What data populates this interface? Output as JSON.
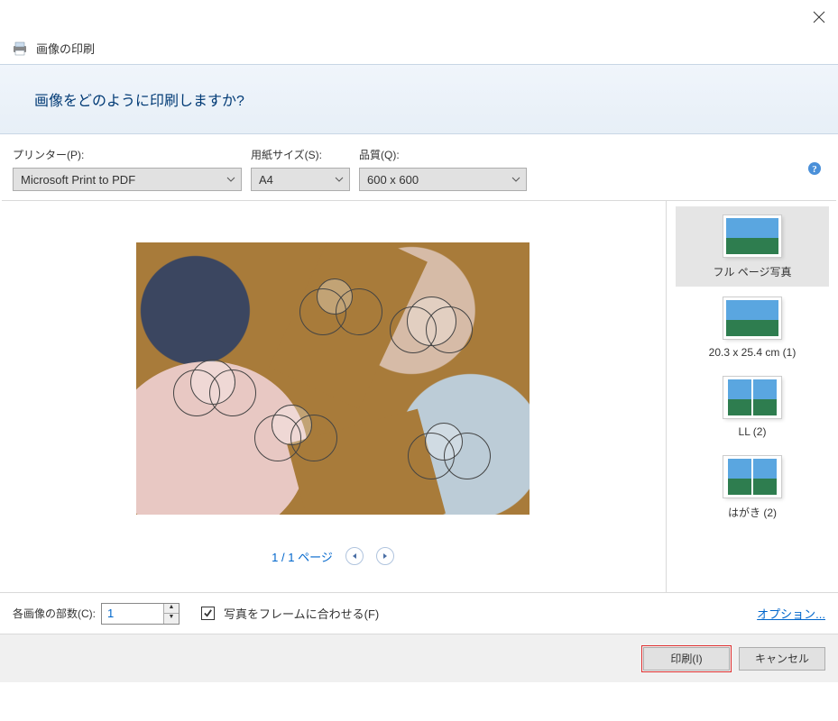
{
  "window": {
    "title": "画像の印刷"
  },
  "banner": {
    "question": "画像をどのように印刷しますか?"
  },
  "controls": {
    "printer_label": "プリンター(P):",
    "printer_value": "Microsoft Print to PDF",
    "paper_label": "用紙サイズ(S):",
    "paper_value": "A4",
    "quality_label": "品質(Q):",
    "quality_value": "600 x 600"
  },
  "pager": {
    "text": "1 / 1 ページ"
  },
  "layouts": [
    {
      "label": "フル ページ写真",
      "thumbs": 1,
      "selected": true
    },
    {
      "label": "20.3 x 25.4 cm (1)",
      "thumbs": 1,
      "selected": false
    },
    {
      "label": "LL (2)",
      "thumbs": 2,
      "selected": false
    },
    {
      "label": "はがき (2)",
      "thumbs": 2,
      "selected": false
    }
  ],
  "footer": {
    "copies_label": "各画像の部数(C):",
    "copies_value": "1",
    "fit_frame_label": "写真をフレームに合わせる(F)",
    "options_link": "オプション..."
  },
  "buttons": {
    "print": "印刷(I)",
    "cancel": "キャンセル"
  }
}
